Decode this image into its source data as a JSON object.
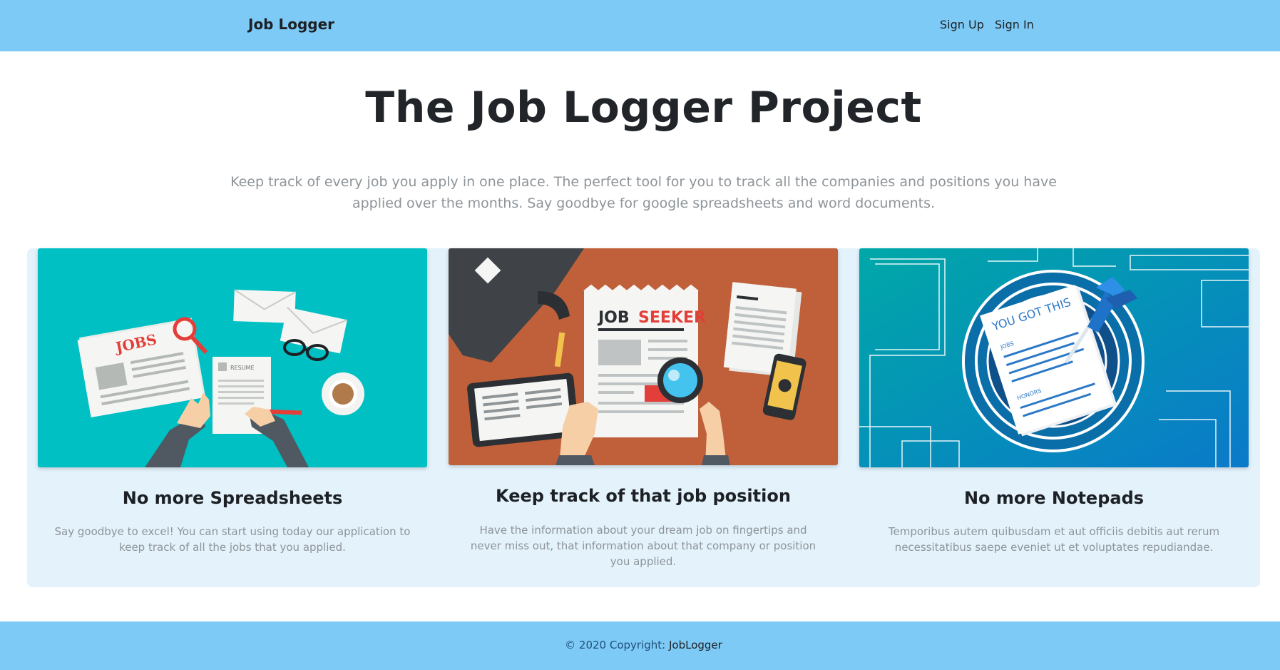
{
  "navbar": {
    "brand": "Job Logger",
    "links": [
      "Sign Up",
      "Sign In"
    ]
  },
  "hero": {
    "title": "The Job Logger Project",
    "subtitle": "Keep track of every job you apply in one place. The perfect tool for you to track all the companies and positions you have applied over the months. Say goodbye for google spreadsheets and word documents."
  },
  "cards": [
    {
      "title": "No more Spreadsheets",
      "text": "Say goodbye to excel! You can start using today our application to keep track of all the jobs that you applied.",
      "image": {
        "bg": "#00c0c3",
        "labels": [
          "JOBS",
          "RESUME"
        ]
      }
    },
    {
      "title": "Keep track of that job position",
      "text": "Have the information about your dream job on fingertips and never miss out, that information about that company or position you applied.",
      "image": {
        "bg": "#c0603a",
        "labels": [
          "JOB",
          "SEEKER"
        ]
      }
    },
    {
      "title": "No more Notepads",
      "text": "Temporibus autem quibusdam et aut officiis debitis aut rerum necessitatibus saepe eveniet ut et voluptates repudiandae.",
      "image": {
        "bg": "#0a8fc7",
        "labels": [
          "YOU GOT THIS",
          "JOBS",
          "HONORS"
        ]
      }
    }
  ],
  "footer": {
    "copyright": "© 2020 Copyright: ",
    "link": "JobLogger"
  },
  "colors": {
    "navbar": "#7ecaf6",
    "cards_bg": "#e3f2fb",
    "text_muted": "#8e9499"
  }
}
